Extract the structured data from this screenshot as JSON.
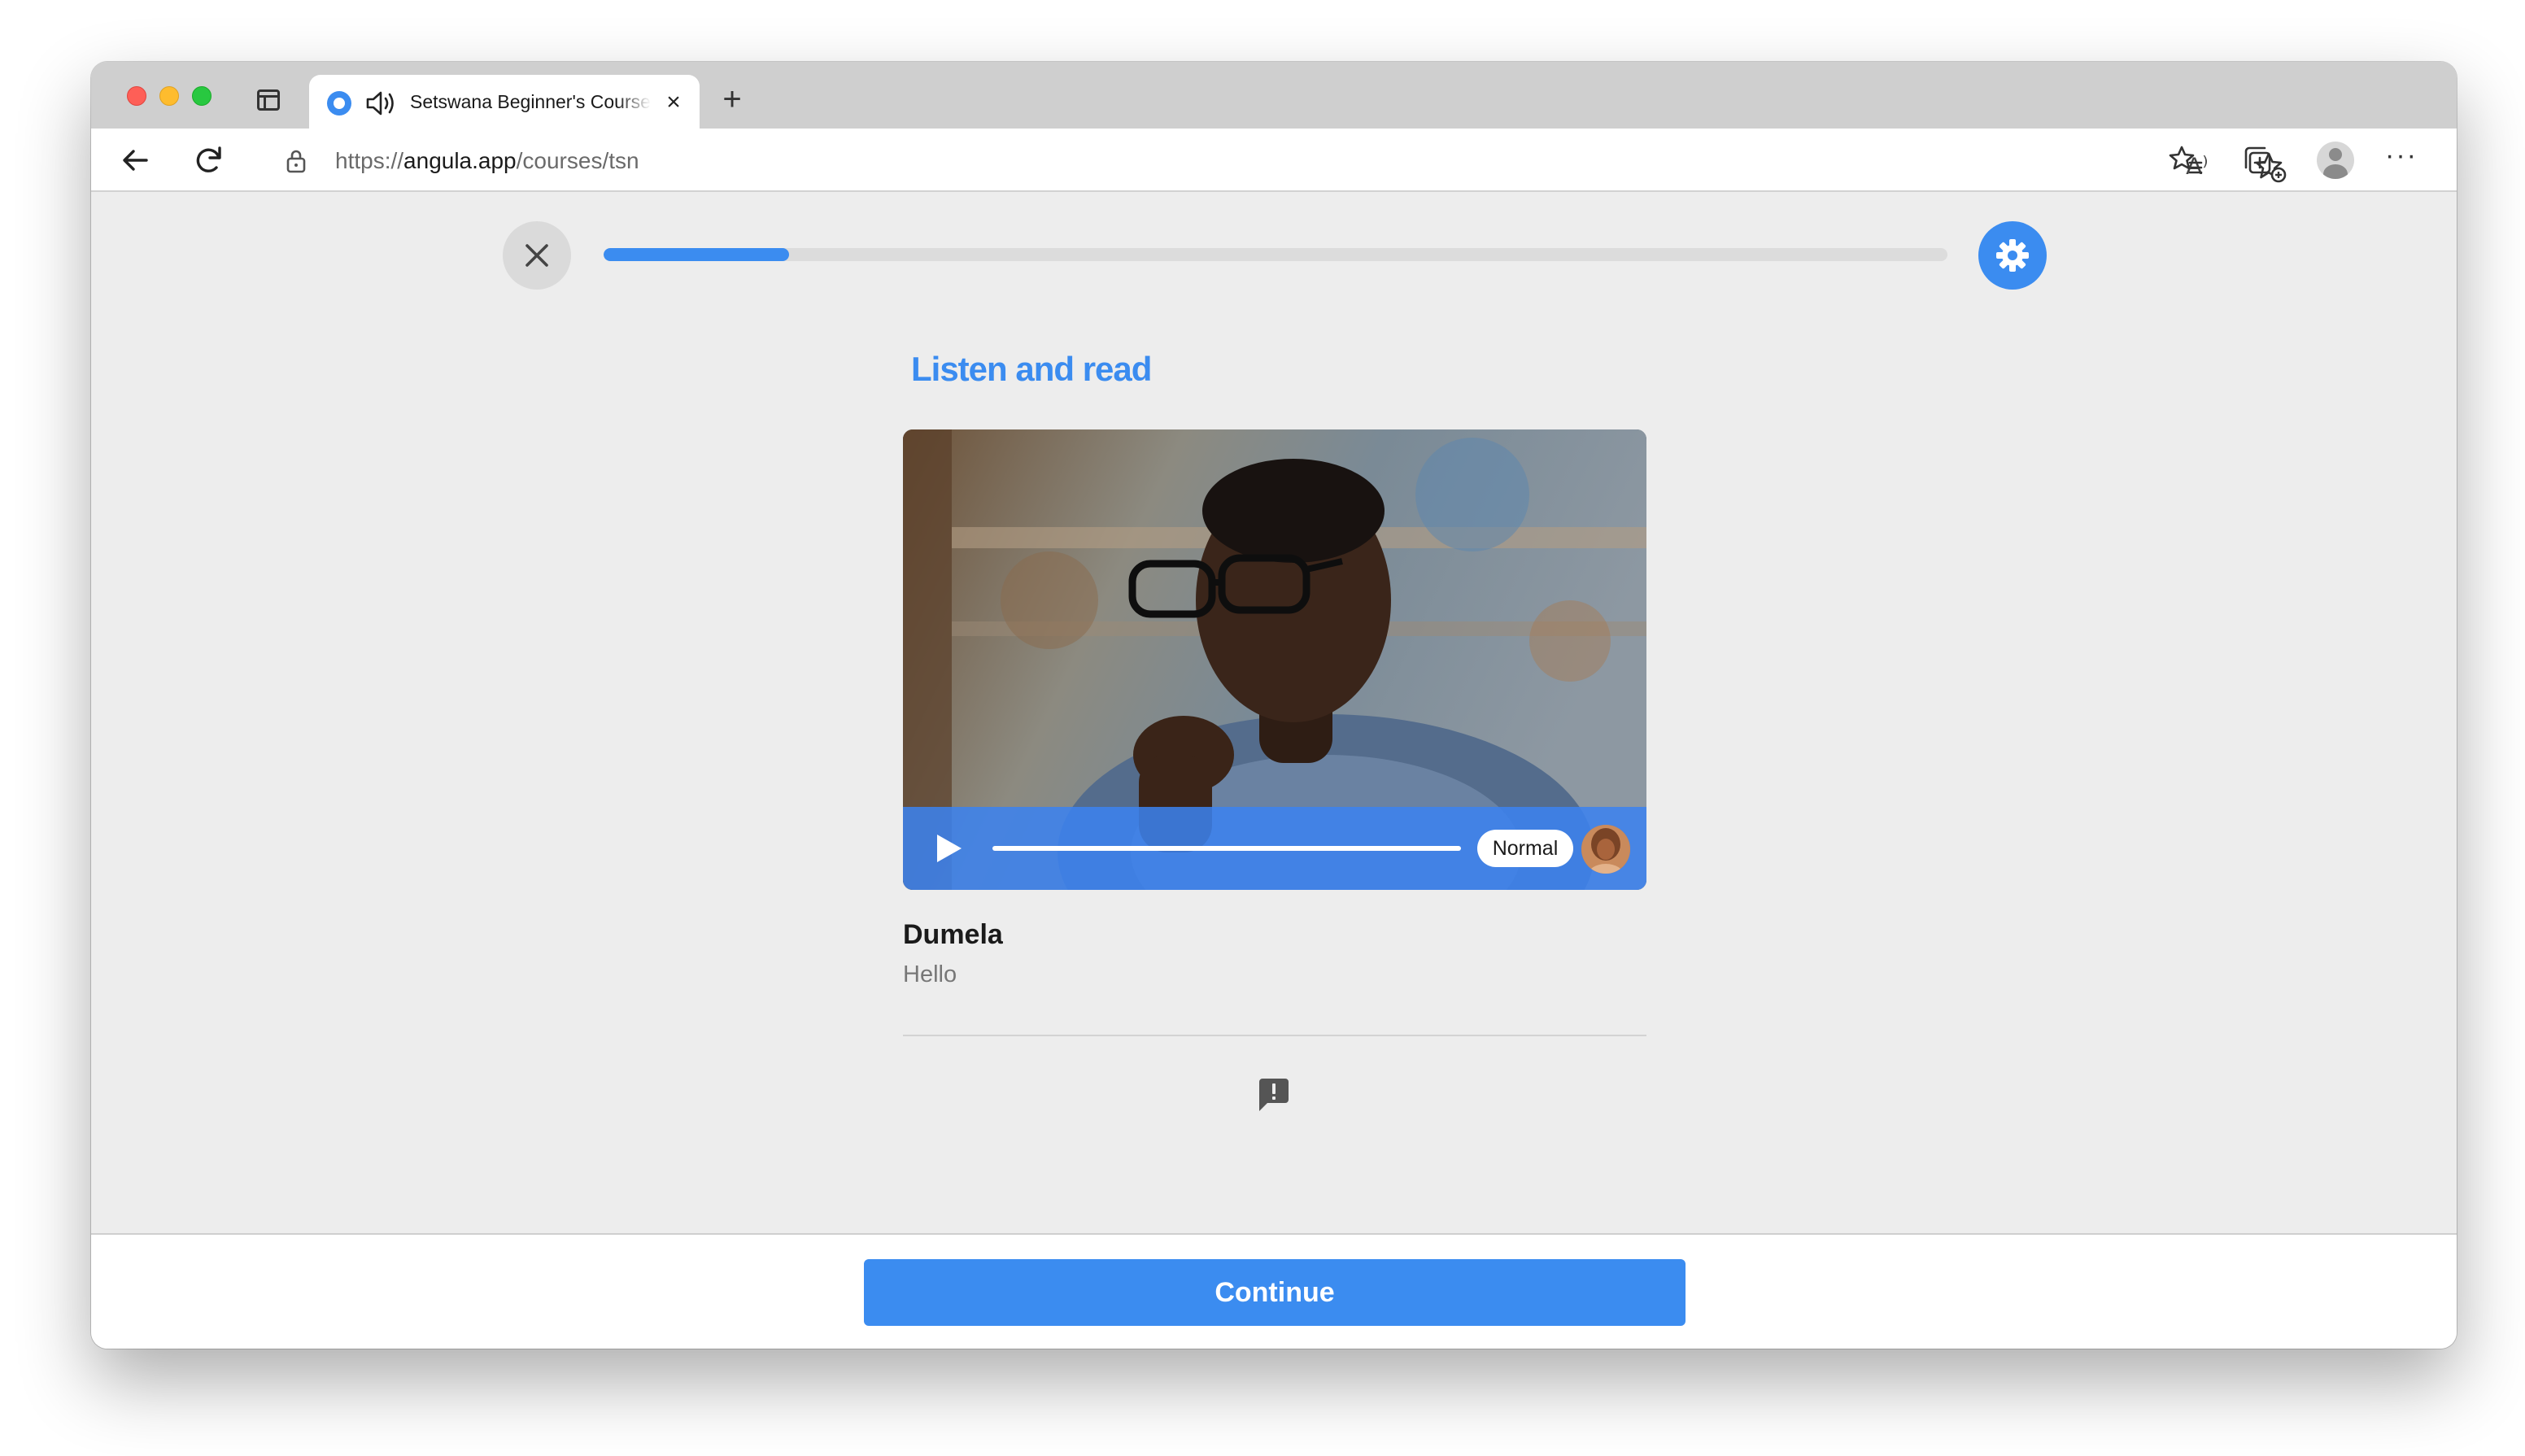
{
  "browser": {
    "tab_title": "Setswana Beginner's Course",
    "url_scheme": "https://",
    "url_domain": "angula.app",
    "url_path": "/courses/tsn",
    "read_aloud_label": "A⁾"
  },
  "lesson": {
    "progress_fraction": 0.138,
    "heading": "Listen and read",
    "player": {
      "speed_label": "Normal"
    },
    "phrase": "Dumela",
    "translation": "Hello"
  },
  "footer": {
    "continue_label": "Continue"
  },
  "colors": {
    "accent": "#3b8cf0",
    "page_background": "#ededed",
    "progress_track": "#dcdcdc"
  },
  "icons": [
    "sidebar-icon",
    "audio-icon",
    "close-icon",
    "plus-icon",
    "back-arrow-icon",
    "reload-icon",
    "lock-icon",
    "read-aloud-icon",
    "favorite-add-icon",
    "favorites-icon",
    "collections-icon",
    "profile-icon",
    "more-icon",
    "gear-icon",
    "play-icon",
    "report-icon"
  ]
}
